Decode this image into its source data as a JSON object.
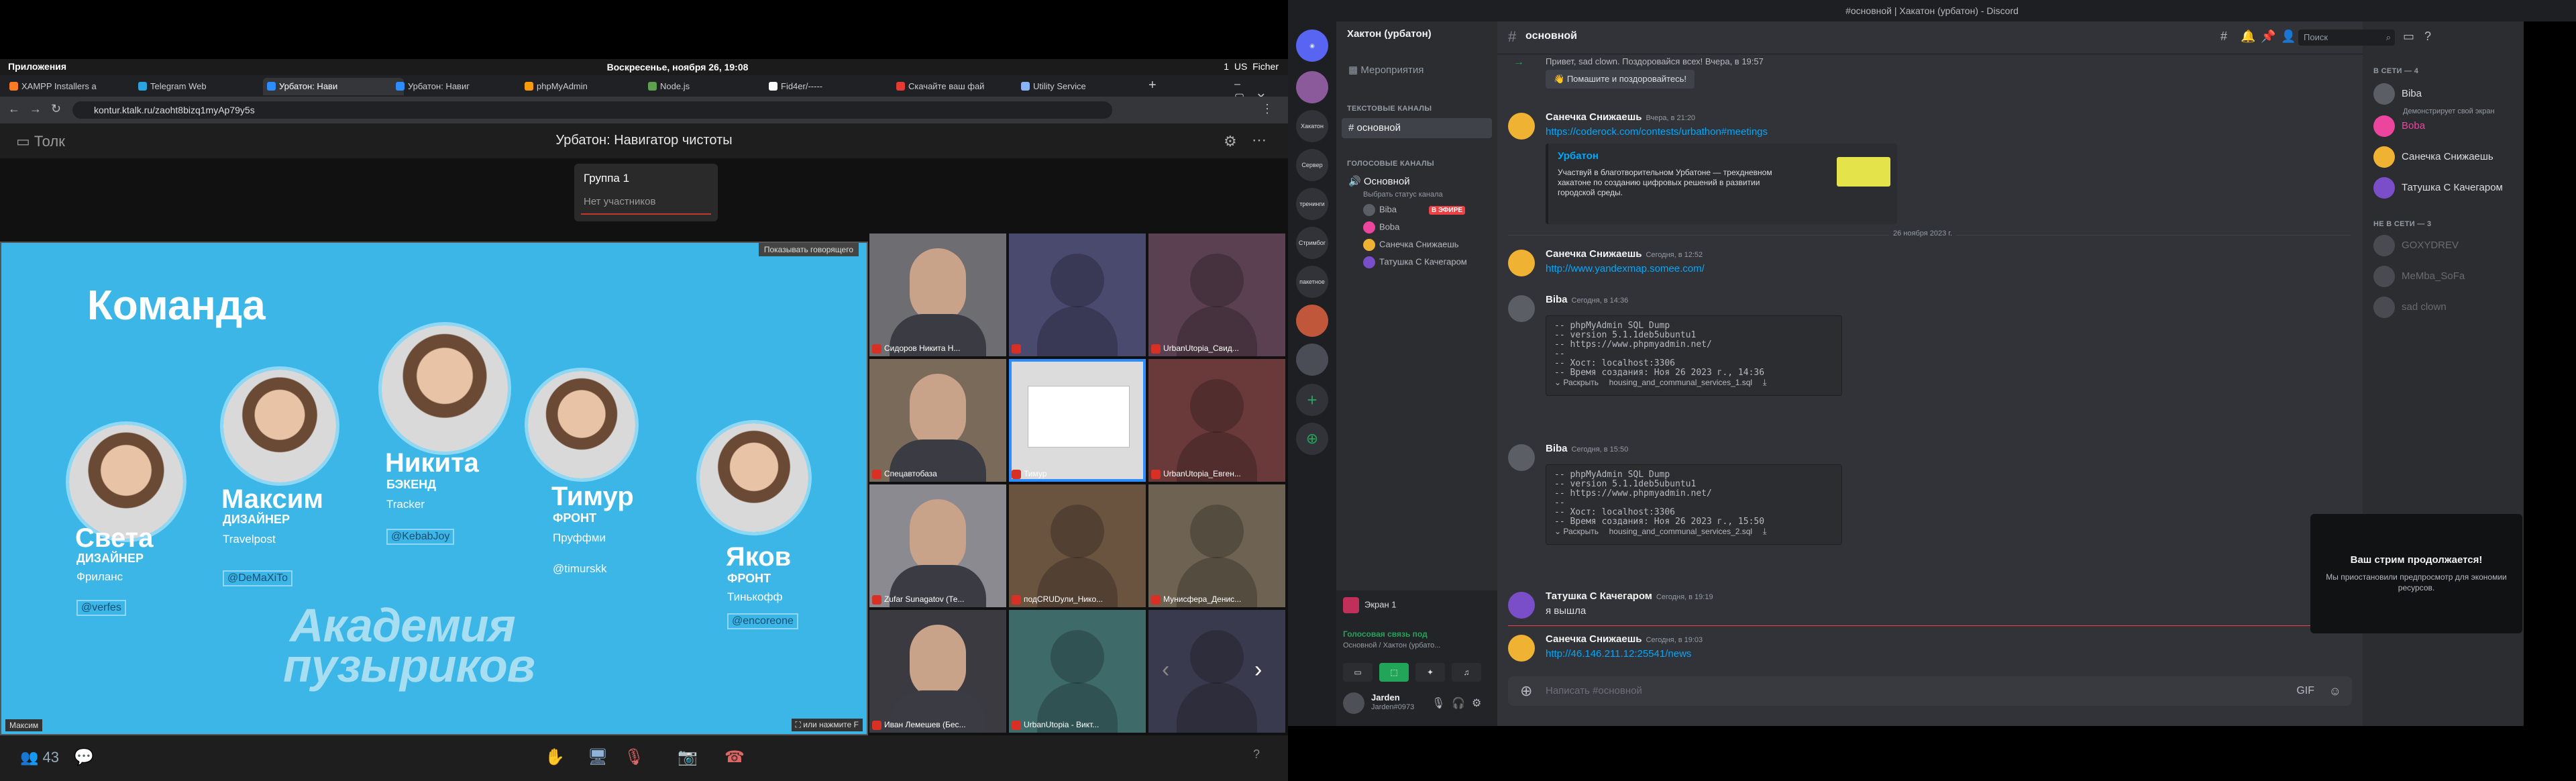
{
  "os": {
    "apps_label": "Приложения",
    "clock": "Воскресенье, ноября 26, 19:08",
    "tray_items": [
      "1",
      "US",
      "Ficher"
    ]
  },
  "browser": {
    "tabs": [
      {
        "label": "XAMPP Installers a"
      },
      {
        "label": "Telegram Web"
      },
      {
        "label": "Урбатон: Нави"
      },
      {
        "label": "Урбатон: Навиг"
      },
      {
        "label": "phpMyAdmin"
      },
      {
        "label": "Node.js"
      },
      {
        "label": "Fid4er/-----"
      },
      {
        "label": "Скачайте ваш фай"
      },
      {
        "label": "Utility Service"
      }
    ],
    "url": "kontur.ktalk.ru/zaoht8bizq1myAp79y5s"
  },
  "talk": {
    "logo": "Толк",
    "title": "Урбатон: Навигатор чистоты",
    "group": {
      "name": "Группа 1",
      "status": "Нет участников"
    },
    "show_speaker_btn": "Показывать говорящего",
    "presenter_tag": "Максим",
    "exit_hint": "или нажмите F",
    "participants_count": "43",
    "slide": {
      "heading": "Команда",
      "brand": [
        "Академия",
        "пузыриков"
      ],
      "people": [
        {
          "name": "Света",
          "role": "ДИЗАЙНЕР",
          "company": "Фриланс",
          "handle": "@verfes"
        },
        {
          "name": "Максим",
          "role": "ДИЗАЙНЕР",
          "company": "Travelpost",
          "handle": "@DeMaXiTo"
        },
        {
          "name": "Никита",
          "role": "БЭКЕНД",
          "company": "Tracker",
          "handle": "@KebabJoy"
        },
        {
          "name": "Тимур",
          "role": "ФРОНТ",
          "company": "Пруффми",
          "handle": "@timurskk"
        },
        {
          "name": "Яков",
          "role": "ФРОНТ",
          "company": "Тинькофф",
          "handle": "@encoreone"
        }
      ]
    },
    "tiles": [
      {
        "label": "Сидоров Никита Н...",
        "type": "cam"
      },
      {
        "label": "",
        "type": "avatar"
      },
      {
        "label": "UrbanUtopia_Свид...",
        "type": "avatar"
      },
      {
        "label": "Спецавтобаза",
        "type": "cam"
      },
      {
        "label": "Тимур",
        "type": "screen"
      },
      {
        "label": "UrbanUtopia_Евген...",
        "type": "avatar"
      },
      {
        "label": "Zufar Sunagatov (Те...",
        "type": "cam"
      },
      {
        "label": "подCRUDули_Нико...",
        "type": "avatar"
      },
      {
        "label": "Мунисфера_Денис...",
        "type": "avatar"
      },
      {
        "label": "Иван Лемешев (Бес...",
        "type": "cam"
      },
      {
        "label": "UrbanUtopia - Викт...",
        "type": "avatar"
      },
      {
        "label": "",
        "type": "avatar"
      }
    ]
  },
  "discord": {
    "window_title": "#основной | Хакатон (урбатон) - Discord",
    "server_name": "Хактон (урбатон)",
    "events_label": "Мероприятия",
    "text_category": "ТЕКСТОВЫЕ КАНАЛЫ",
    "voice_category": "ГОЛОСОВЫЕ КАНАЛЫ",
    "channel_active": "основной",
    "voice_channel": "Основной",
    "voice_status_hint": "Выбрать статус канала",
    "voice_users": [
      "Biba",
      "Boba",
      "Санечка Снижаешь",
      "Татушка С Качегаром"
    ],
    "live_badge": "В ЭФИРЕ",
    "guild_labels": [
      "Хакатон",
      "Сервер",
      "тренинги",
      "Стримбог",
      "пакетное"
    ],
    "screen_share_label": "Экран 1",
    "voice_connected": "Голосовая связь под",
    "voice_location": "Основной / Хактон (урбато...",
    "user_name": "Jarden",
    "user_tag": "Jarden#0973",
    "search_placeholder": "Поиск",
    "greeting": {
      "text": "Привет, sad clown. Поздоровайся всех! Вчера, в 19:57",
      "button": "Помашите и поздоровайтесь!"
    },
    "messages": [
      {
        "author": "Санечка Снижаешь",
        "time": "Вчера, в 21:20",
        "text": "https://coderock.com/contests/urbathon#meetings",
        "link": true,
        "embed": {
          "title": "Урбатон",
          "body": "Участвуй в благотворительном Урбатоне — трехдневном хакатоне по созданию цифровых решений в развитии городской среды."
        }
      },
      {
        "author": "Санечка Снижаешь",
        "time": "Сегодня, в 12:52",
        "text": "http://www.yandexmap.somee.com/",
        "link": true
      },
      {
        "author": "Biba",
        "time": "Сегодня, в 14:36",
        "code": [
          "-- phpMyAdmin SQL Dump",
          "-- version 5.1.1deb5ubuntu1",
          "-- https://www.phpmyadmin.net/",
          "--",
          "-- Хост: localhost:3306",
          "-- Время создания: Ноя 26 2023 г., 14:36"
        ],
        "file": "housing_and_communal_services_1.sql"
      },
      {
        "author": "Biba",
        "time": "Сегодня, в 15:50",
        "code": [
          "-- phpMyAdmin SQL Dump",
          "-- version 5.1.1deb5ubuntu1",
          "-- https://www.phpmyadmin.net/",
          "--",
          "-- Хост: localhost:3306",
          "-- Время создания: Ноя 26 2023 г., 15:50"
        ],
        "file": "housing_and_communal_services_2.sql"
      },
      {
        "author": "Татушка С Качегаром",
        "time": "Сегодня, в 19:19",
        "text": "я вышла"
      },
      {
        "author": "Санечка Снижаешь",
        "time": "Сегодня, в 19:03",
        "text": "http://46.146.211.12:25541/news",
        "link": true
      }
    ],
    "date_divider": "26 ноября 2023 г.",
    "expand_label": "Раскрыть",
    "input_placeholder": "Написать #основной",
    "members": {
      "online_header": "В СЕТИ — 4",
      "online": [
        {
          "name": "Biba",
          "sub": "Демонстрирует свой экран"
        },
        {
          "name": "Boba",
          "sub": ""
        },
        {
          "name": "Санечка Снижаешь",
          "sub": ""
        },
        {
          "name": "Татушка С Качегаром",
          "sub": ""
        }
      ],
      "offline_header": "НЕ В СЕТИ — 3",
      "offline": [
        "GOXYDREV",
        "MeMba_SoFa",
        "sad clown"
      ]
    },
    "toast": {
      "title": "Ваш стрим продолжается!",
      "body": "Мы приостановили предпросмотр для экономии ресурсов."
    },
    "colors": {
      "bg": "#313338",
      "sidebar": "#2b2d31",
      "link": "#00a8fc",
      "live": "#ed4245"
    }
  }
}
